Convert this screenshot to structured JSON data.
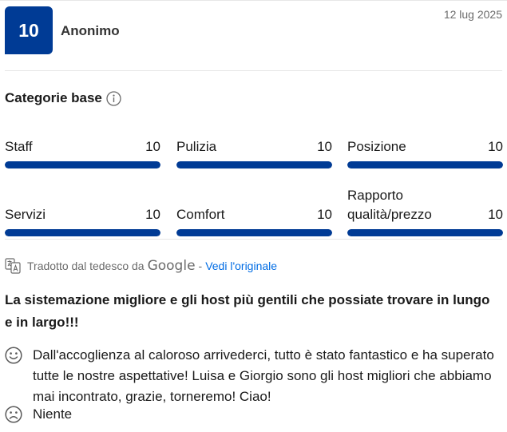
{
  "review": {
    "score": "10",
    "reviewer": "Anonimo",
    "date": "12 lug 2025"
  },
  "categories": {
    "title": "Categorie base",
    "items": [
      {
        "label": "Staff",
        "value": "10",
        "fill": 1.0
      },
      {
        "label": "Pulizia",
        "value": "10",
        "fill": 1.0
      },
      {
        "label": "Posizione",
        "value": "10",
        "fill": 1.0
      },
      {
        "label": "Servizi",
        "value": "10",
        "fill": 1.0
      },
      {
        "label": "Comfort",
        "value": "10",
        "fill": 1.0
      },
      {
        "label": "Rapporto qualità/prezzo",
        "value": "10",
        "fill": 1.0
      }
    ]
  },
  "translation": {
    "text": "Tradotto dal tedesco da",
    "provider": "Google",
    "separator": "-",
    "link": "Vedi l'originale"
  },
  "content": {
    "title": "La sistemazione migliore e gli host più gentili che possiate trovare in lungo e in largo!!!",
    "positive": "Dall'accoglienza al caloroso arrivederci, tutto è stato fantastico e ha superato tutte le nostre aspettative! Luisa e Giorgio sono gli host migliori che abbiamo mai incontrato, grazie, torneremo! Ciao!",
    "negative": "Niente"
  },
  "colors": {
    "accent": "#003b95",
    "link": "#006ce4",
    "muted": "#6b6b6b"
  },
  "icons": {
    "info": "info-icon",
    "translate": "translate-icon",
    "positive": "smile-icon",
    "negative": "frown-icon"
  }
}
